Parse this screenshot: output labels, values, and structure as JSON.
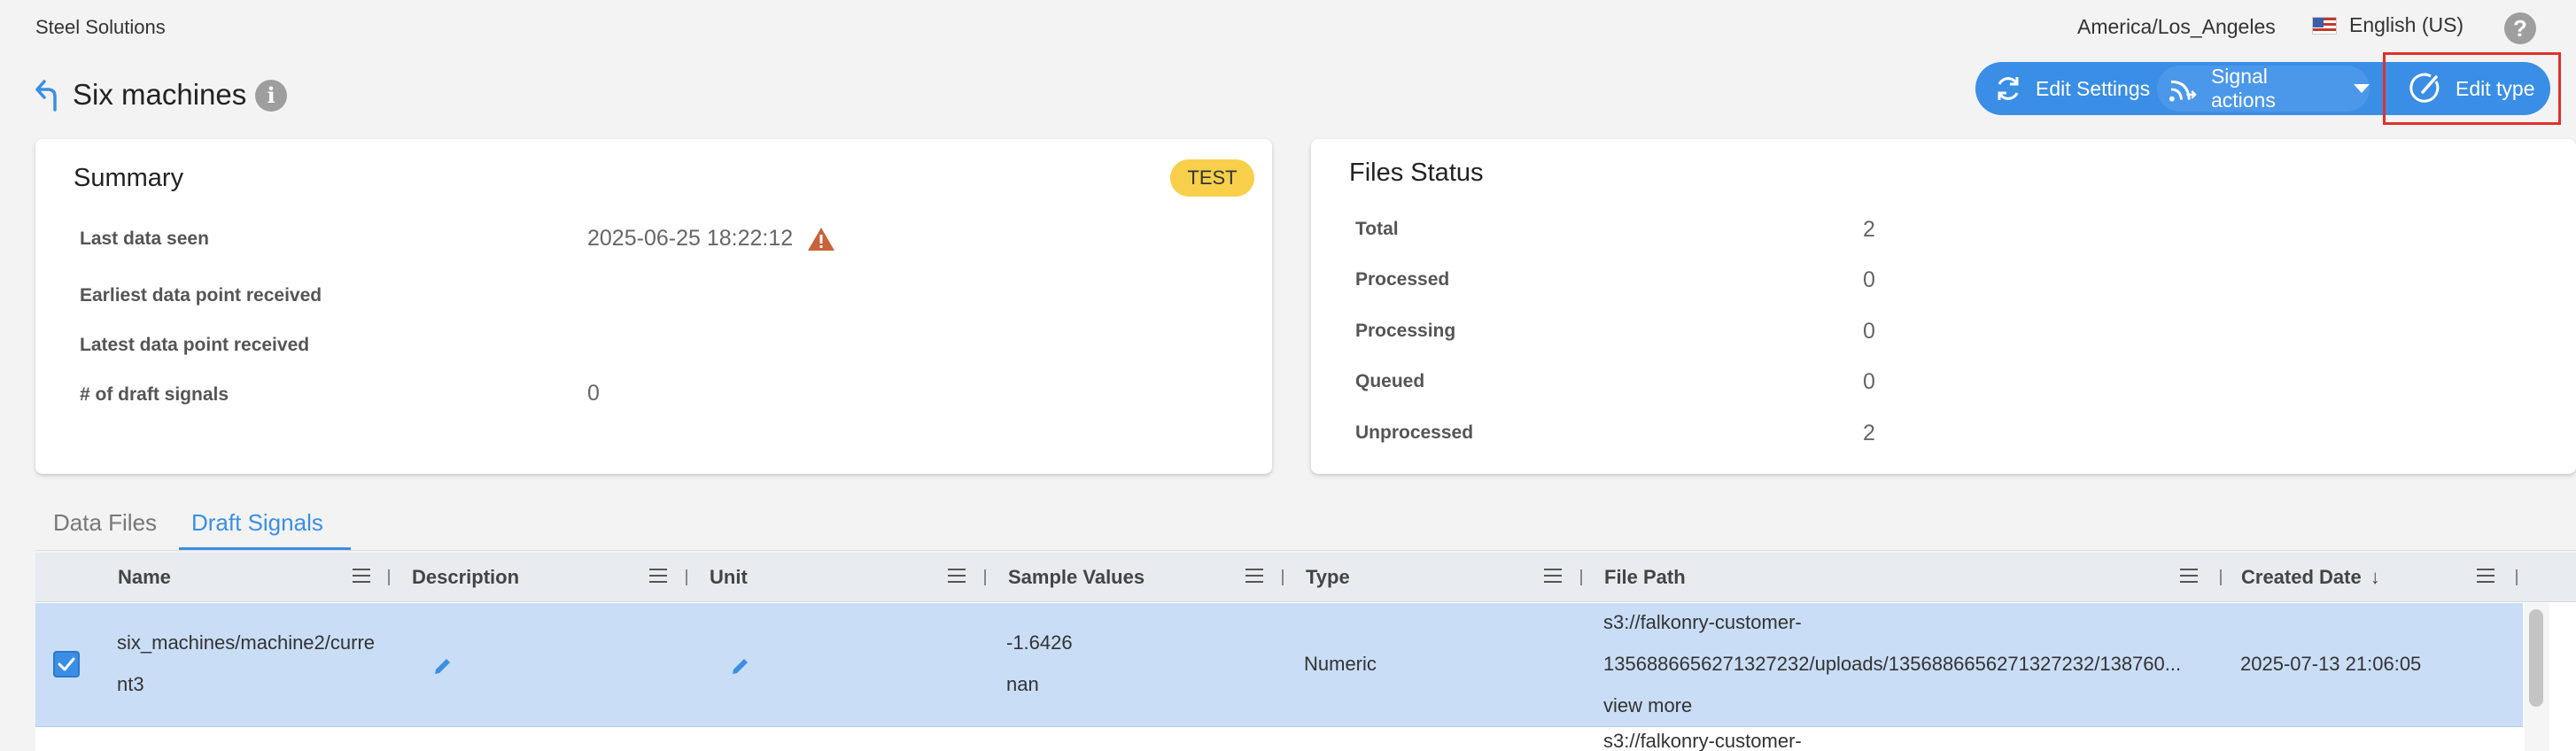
{
  "header": {
    "org_name": "Steel Solutions",
    "timezone": "America/Los_Angeles",
    "language": "English (US)",
    "help_icon": "?"
  },
  "page": {
    "title": "Six machines",
    "info_icon": "i"
  },
  "actions": {
    "edit_settings": "Edit Settings",
    "signal_actions": "Signal actions",
    "edit_type": "Edit type"
  },
  "summary": {
    "title": "Summary",
    "badge": "TEST",
    "rows": [
      {
        "label": "Last data seen",
        "value": "2025-06-25 18:22:12"
      },
      {
        "label": "Earliest data point received",
        "value": ""
      },
      {
        "label": "Latest data point received",
        "value": ""
      },
      {
        "label": "# of draft signals",
        "value": "0"
      }
    ]
  },
  "files_status": {
    "title": "Files Status",
    "rows": [
      {
        "label": "Total",
        "value": "2"
      },
      {
        "label": "Processed",
        "value": "0"
      },
      {
        "label": "Processing",
        "value": "0"
      },
      {
        "label": "Queued",
        "value": "0"
      },
      {
        "label": "Unprocessed",
        "value": "2"
      }
    ]
  },
  "tabs": [
    {
      "label": "Data Files",
      "active": false
    },
    {
      "label": "Draft Signals",
      "active": true
    }
  ],
  "table": {
    "columns": [
      "Name",
      "Description",
      "Unit",
      "Sample Values",
      "Type",
      "File Path",
      "Created Date"
    ],
    "sort_indicator": "↓",
    "rows": [
      {
        "selected": true,
        "name_line1": "six_machines/machine2/curre",
        "name_line2": "nt3",
        "sample_value_1": "-1.6426",
        "sample_value_2": "nan",
        "type": "Numeric",
        "file_path_line1": "s3://falkonry-customer-",
        "file_path_line2": "1356886656271327232/uploads/1356886656271327232/138760...",
        "view_more": "view more",
        "created_date": "2025-07-13 21:06:05"
      },
      {
        "selected": false,
        "file_path_line1": "s3://falkonry-customer-"
      }
    ]
  },
  "colors": {
    "accent": "#3a8ee6",
    "badge": "#f7cf4a",
    "selected_row": "#c9ddf6",
    "warning": "#c8623a",
    "highlight_box": "#e0302a"
  }
}
